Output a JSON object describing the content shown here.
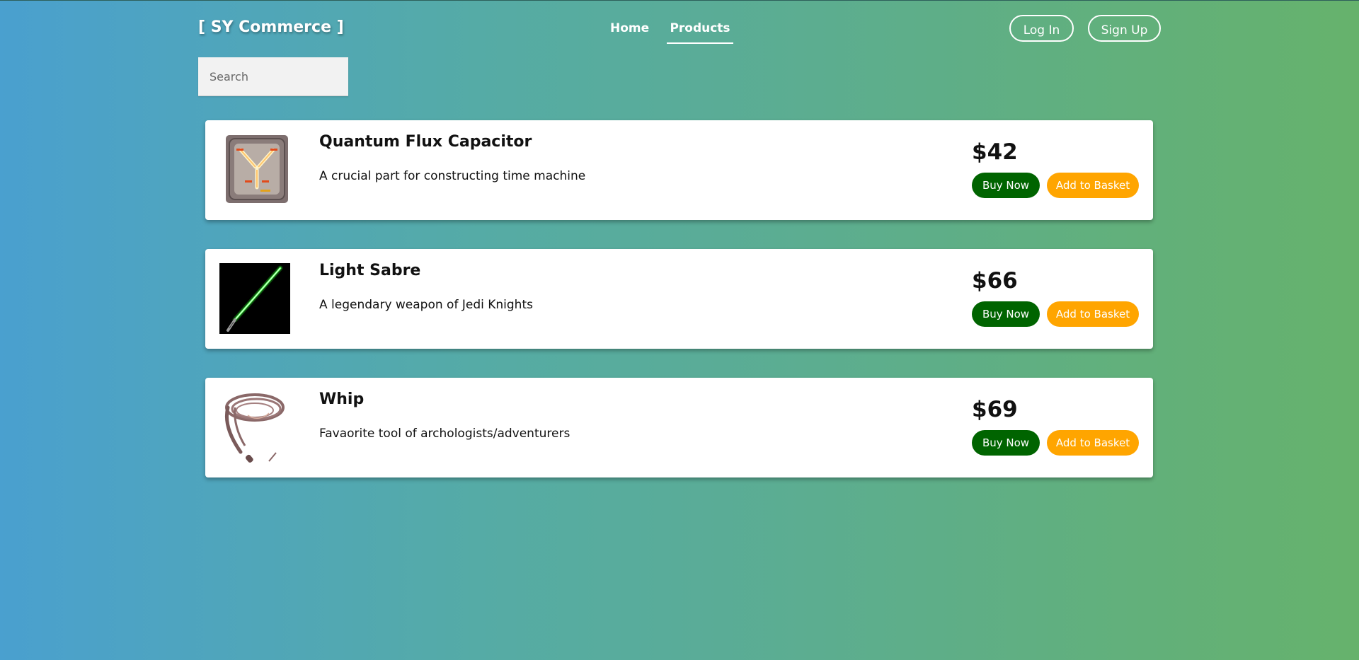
{
  "brand": "[ SY Commerce ]",
  "nav": {
    "home": "Home",
    "products": "Products"
  },
  "auth": {
    "login": "Log In",
    "signup": "Sign Up"
  },
  "search": {
    "placeholder": "Search",
    "value": ""
  },
  "products": [
    {
      "title": "Quantum Flux Capacitor",
      "description": "A crucial part for constructing time machine",
      "price": "$42",
      "icon": "flux-capacitor-image",
      "buy_label": "Buy Now",
      "basket_label": "Add to Basket"
    },
    {
      "title": "Light Sabre",
      "description": "A legendary weapon of Jedi Knights",
      "price": "$66",
      "icon": "light-sabre-image",
      "buy_label": "Buy Now",
      "basket_label": "Add to Basket"
    },
    {
      "title": "Whip",
      "description": "Favaorite tool of archologists/adventurers",
      "price": "$69",
      "icon": "whip-image",
      "buy_label": "Buy Now",
      "basket_label": "Add to Basket"
    }
  ],
  "colors": {
    "gradient_start": "#4aa0cf",
    "gradient_end": "#66b26c",
    "buy_button": "#006400",
    "basket_button": "#ffa500"
  }
}
